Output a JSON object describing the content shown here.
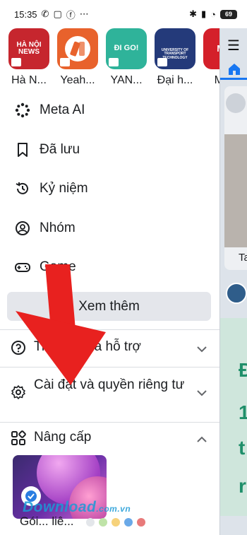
{
  "status_bar": {
    "time": "15:35",
    "battery": "69"
  },
  "shortcuts": [
    {
      "label": "Hà N...",
      "thumb_text": "HÀ NỘI NEWS",
      "bg": "#c6262e"
    },
    {
      "label": "Yeah...",
      "thumb_text": "",
      "bg": "#e8622c"
    },
    {
      "label": "YAN...",
      "thumb_text": "ĐI GO!",
      "bg": "#2fb39a"
    },
    {
      "label": "Đại h...",
      "thumb_text": "UNIVERSITY OF TRANSPORT TECHNOLOGY",
      "bg": "#243a7a"
    },
    {
      "label": "M...",
      "thumb_text": "ME",
      "bg": "#d4202a"
    }
  ],
  "menu": [
    {
      "label": "Meta AI",
      "icon": "meta-ai-icon"
    },
    {
      "label": "Đã lưu",
      "icon": "bookmark-icon"
    },
    {
      "label": "Kỷ niệm",
      "icon": "history-icon"
    },
    {
      "label": "Nhóm",
      "icon": "group-icon"
    },
    {
      "label": "Game",
      "icon": "gamepad-icon"
    }
  ],
  "see_more_label": "Xem thêm",
  "sections": {
    "help": {
      "label": "Trợ giúp và hỗ trợ"
    },
    "settings": {
      "label": "Cài đặt và quyền riêng tư"
    },
    "upgrade": {
      "label": "Nâng cấp"
    }
  },
  "upgrade_card_caption": "Gói... liê...",
  "peek": {
    "tab_text": "Ta"
  },
  "watermark": {
    "text": "Download",
    "suffix": ".com.vn"
  },
  "colors": {
    "accent": "#1877f2",
    "annotation_arrow": "#e8211f",
    "dots": [
      "#e3e6ea",
      "#bfe3a8",
      "#f6d27b",
      "#6aa9e8",
      "#e87a7a"
    ]
  }
}
